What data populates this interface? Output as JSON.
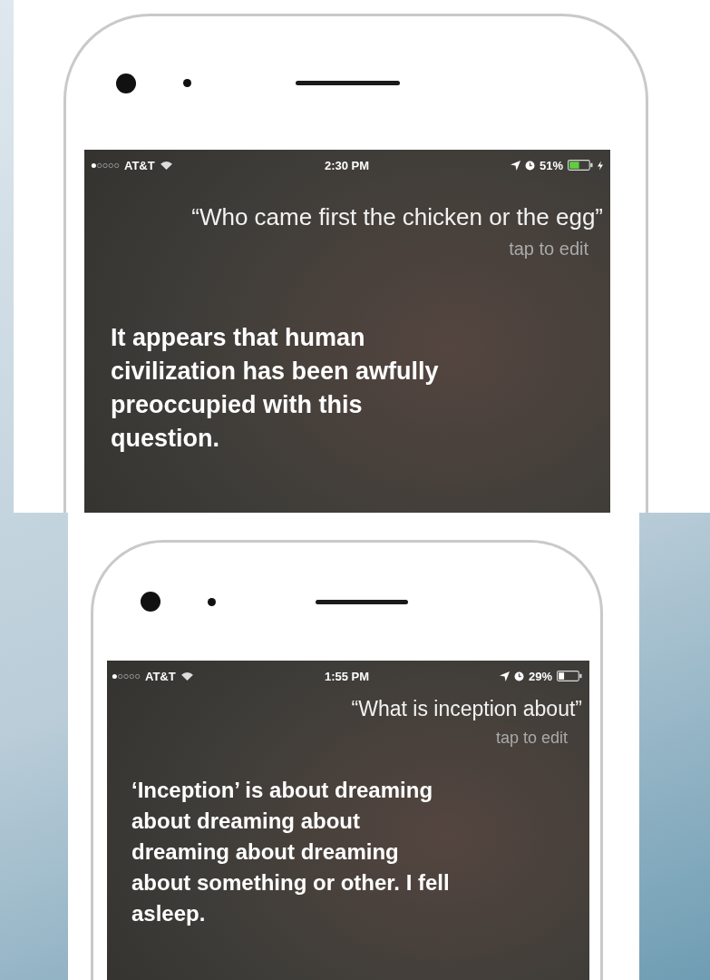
{
  "panels": [
    {
      "status_bar": {
        "carrier": "AT&T",
        "time": "2:30 PM",
        "battery": "51%",
        "charging": true
      },
      "query": "“Who came first the chicken or the egg”",
      "edit_hint": "tap to edit",
      "answer": "It appears that human civilization has been awfully preoccupied with this question."
    },
    {
      "status_bar": {
        "carrier": "AT&T",
        "time": "1:55 PM",
        "battery": "29%",
        "charging": false
      },
      "query": "“What is inception about”",
      "edit_hint": "tap to edit",
      "answer": "‘Inception’ is about dreaming about dreaming about dreaming about dreaming about something or other. I fell asleep."
    }
  ]
}
